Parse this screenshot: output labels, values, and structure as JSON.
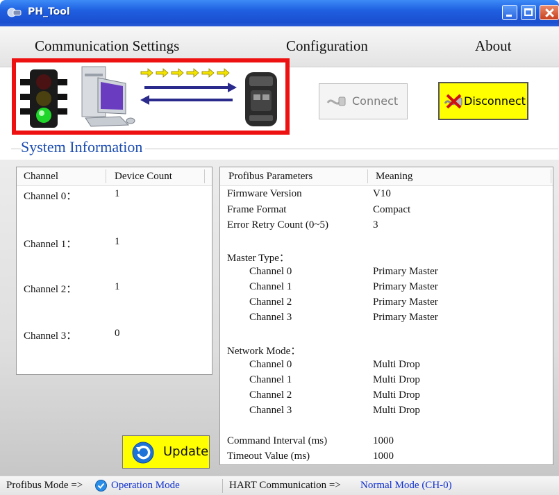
{
  "window": {
    "title": "PH_Tool"
  },
  "menu": {
    "items": [
      {
        "label": "Communication Settings"
      },
      {
        "label": "Configuration"
      },
      {
        "label": "About"
      }
    ]
  },
  "toolbar": {
    "connect_label": "Connect",
    "disconnect_label": "Disconnect"
  },
  "section": {
    "title": "System Information"
  },
  "channels": {
    "headers": [
      "Channel",
      "Device Count"
    ],
    "rows": [
      {
        "channel": "Channel 0：",
        "count": "1"
      },
      {
        "channel": "Channel 1：",
        "count": "1"
      },
      {
        "channel": "Channel 2：",
        "count": "1"
      },
      {
        "channel": "Channel 3：",
        "count": "0"
      }
    ]
  },
  "params": {
    "headers": [
      "Profibus Parameters",
      "Meaning"
    ],
    "rows": [
      {
        "name": "Firmware Version",
        "value": "V10"
      },
      {
        "name": "Frame Format",
        "value": "Compact"
      },
      {
        "name": "Error Retry Count (0~5)",
        "value": "3"
      },
      {
        "name": "Master Type：",
        "value": ""
      },
      {
        "name": "Channel 0",
        "value": "Primary Master"
      },
      {
        "name": "Channel 1",
        "value": "Primary Master"
      },
      {
        "name": "Channel 2",
        "value": "Primary Master"
      },
      {
        "name": "Channel 3",
        "value": "Primary Master"
      },
      {
        "name": "Network Mode：",
        "value": ""
      },
      {
        "name": "Channel 0",
        "value": "Multi Drop"
      },
      {
        "name": "Channel 1",
        "value": "Multi Drop"
      },
      {
        "name": "Channel 2",
        "value": "Multi Drop"
      },
      {
        "name": "Channel 3",
        "value": "Multi Drop"
      },
      {
        "name": "Command Interval (ms)",
        "value": "1000"
      },
      {
        "name": "Timeout Value (ms)",
        "value": "1000"
      }
    ]
  },
  "update_label": "Update",
  "status": {
    "profibus_label": "Profibus Mode =>",
    "profibus_value": "Operation Mode",
    "hart_label": "HART Communication =>",
    "hart_value": "Normal Mode (CH-0)"
  },
  "colors": {
    "title_bar": "#1f5fe0",
    "banner_border": "#ee1111",
    "button_highlight": "#ffff00",
    "section_title": "#1c4db0",
    "status_value": "#1030d0"
  }
}
